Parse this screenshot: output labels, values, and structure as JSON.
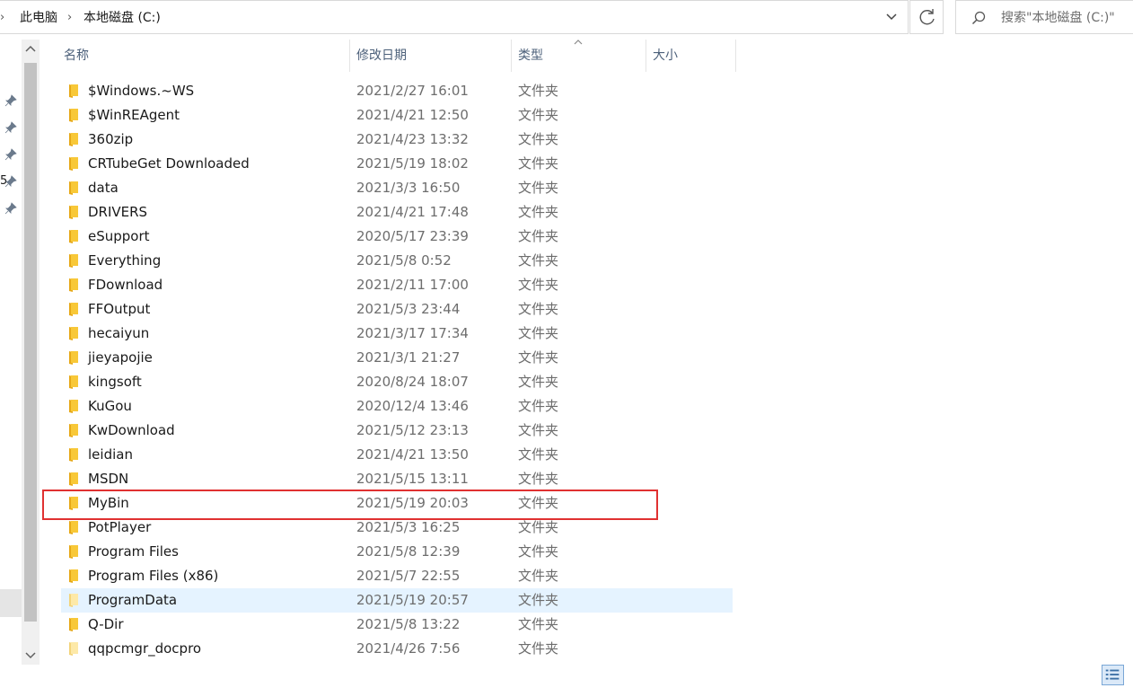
{
  "address": {
    "breadcrumbs": [
      "此电脑",
      "本地磁盘 (C:)"
    ]
  },
  "search": {
    "placeholder": "搜索\"本地磁盘 (C:)\""
  },
  "nav": {
    "truncated_label": "5"
  },
  "columns": {
    "name": "名称",
    "date": "修改日期",
    "type": "类型",
    "size": "大小"
  },
  "files": [
    {
      "name": "$Windows.~WS",
      "date": "2021/2/27 16:01",
      "type": "文件夹"
    },
    {
      "name": "$WinREAgent",
      "date": "2021/4/21 12:50",
      "type": "文件夹"
    },
    {
      "name": "360zip",
      "date": "2021/4/23 13:32",
      "type": "文件夹"
    },
    {
      "name": "CRTubeGet Downloaded",
      "date": "2021/5/19 18:02",
      "type": "文件夹"
    },
    {
      "name": "data",
      "date": "2021/3/3 16:50",
      "type": "文件夹"
    },
    {
      "name": "DRIVERS",
      "date": "2021/4/21 17:48",
      "type": "文件夹"
    },
    {
      "name": "eSupport",
      "date": "2020/5/17 23:39",
      "type": "文件夹"
    },
    {
      "name": "Everything",
      "date": "2021/5/8 0:52",
      "type": "文件夹"
    },
    {
      "name": "FDownload",
      "date": "2021/2/11 17:00",
      "type": "文件夹"
    },
    {
      "name": "FFOutput",
      "date": "2021/5/3 23:44",
      "type": "文件夹"
    },
    {
      "name": "hecaiyun",
      "date": "2021/3/17 17:34",
      "type": "文件夹"
    },
    {
      "name": "jieyapojie",
      "date": "2021/3/1 21:27",
      "type": "文件夹"
    },
    {
      "name": "kingsoft",
      "date": "2020/8/24 18:07",
      "type": "文件夹"
    },
    {
      "name": "KuGou",
      "date": "2020/12/4 13:46",
      "type": "文件夹"
    },
    {
      "name": "KwDownload",
      "date": "2021/5/12 23:13",
      "type": "文件夹"
    },
    {
      "name": "leidian",
      "date": "2021/4/21 13:50",
      "type": "文件夹"
    },
    {
      "name": "MSDN",
      "date": "2021/5/15 13:11",
      "type": "文件夹"
    },
    {
      "name": "MyBin",
      "date": "2021/5/19 20:03",
      "type": "文件夹",
      "highlighted": true
    },
    {
      "name": "PotPlayer",
      "date": "2021/5/3 16:25",
      "type": "文件夹"
    },
    {
      "name": "Program Files",
      "date": "2021/5/8 12:39",
      "type": "文件夹"
    },
    {
      "name": "Program Files (x86)",
      "date": "2021/5/7 22:55",
      "type": "文件夹"
    },
    {
      "name": "ProgramData",
      "date": "2021/5/19 20:57",
      "type": "文件夹",
      "selected": true,
      "faded": true
    },
    {
      "name": "Q-Dir",
      "date": "2021/5/8 13:22",
      "type": "文件夹"
    },
    {
      "name": "qqpcmgr_docpro",
      "date": "2021/4/26 7:56",
      "type": "文件夹",
      "faded": true
    }
  ],
  "colors": {
    "folder": "#f8c838",
    "folder_dark": "#e6a817",
    "selection": "#e5f3ff",
    "highlight_box": "#e03131",
    "header_text": "#4c607a"
  }
}
